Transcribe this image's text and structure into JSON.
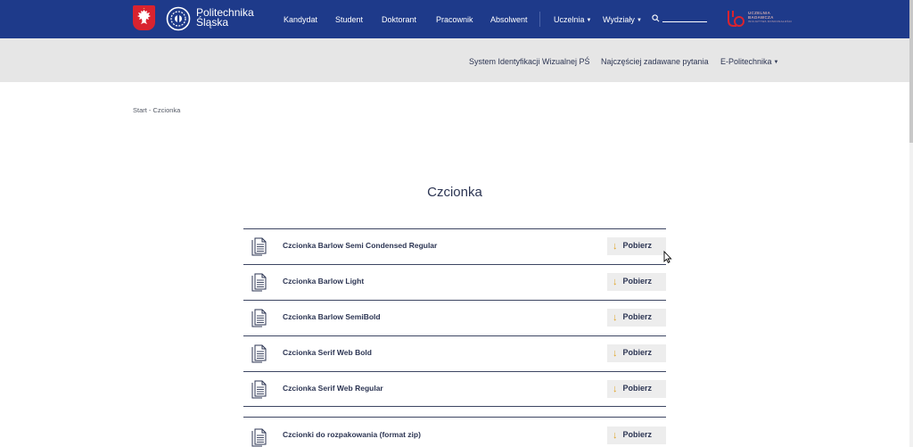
{
  "header": {
    "brand_line1": "Politechnika",
    "brand_line2": "Śląska",
    "nav": [
      {
        "label": "Kandydat"
      },
      {
        "label": "Student"
      },
      {
        "label": "Doktorant"
      },
      {
        "label": "Pracownik"
      },
      {
        "label": "Absolwent"
      },
      {
        "label": "Uczelnia",
        "dropdown": true
      },
      {
        "label": "Wydziały",
        "dropdown": true
      }
    ],
    "search": {
      "value": "",
      "placeholder": ""
    },
    "partner_logo_text": [
      "UCZELNIA",
      "BADAWCZA",
      "INICJATYWA DOSKONAŁOŚCI"
    ],
    "colors": {
      "bar": "#1e3a8a",
      "eagle_bg": "#d9232f",
      "partner_logo": "#d9232f"
    }
  },
  "subnav": [
    {
      "label": "System Identyfikacji Wizualnej PŚ"
    },
    {
      "label": "Najczęściej zadawane pytania"
    },
    {
      "label": "E-Politechnika",
      "dropdown": true
    }
  ],
  "breadcrumb": "Start - Czcionka",
  "page_title": "Czcionka",
  "files": [
    {
      "name": "Czcionka Barlow Semi Condensed Regular",
      "action": "Pobierz"
    },
    {
      "name": "Czcionka Barlow Light",
      "action": "Pobierz"
    },
    {
      "name": "Czcionka Barlow SemiBold",
      "action": "Pobierz"
    },
    {
      "name": "Czcionka Serif Web Bold",
      "action": "Pobierz"
    },
    {
      "name": "Czcionka Serif Web Regular",
      "action": "Pobierz"
    }
  ],
  "zip_file": {
    "name": "Czcionki do rozpakowania (format zip)",
    "action": "Pobierz"
  },
  "icons": {
    "file": "document-icon",
    "download": "arrow-down-icon",
    "search": "search-icon",
    "dropdown": "caret-down-icon"
  },
  "accent": "#e0a325"
}
